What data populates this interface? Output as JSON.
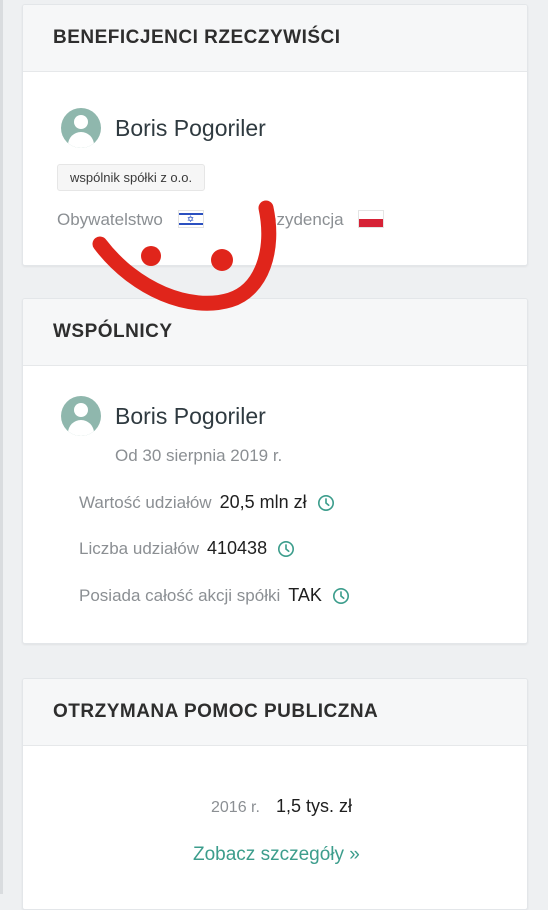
{
  "beneficiaries": {
    "title": "BENEFICJENCI RZECZYWIŚCI",
    "person_name": "Boris Pogoriler",
    "role": "wspólnik spółki z o.o.",
    "citizenship_label": "Obywatelstwo",
    "residence_label": "ezydencja",
    "citizenship_flag_icon": "israel-flag-icon",
    "residence_flag_icon": "poland-flag-icon"
  },
  "partners": {
    "title": "WSPÓLNICY",
    "person_name": "Boris Pogoriler",
    "since": "Od 30 sierpnia 2019 r.",
    "share_value_label": "Wartość udziałów",
    "share_value": "20,5 mln zł",
    "share_count_label": "Liczba udziałów",
    "share_count": "410438",
    "owns_all_label": "Posiada całość akcji spółki",
    "owns_all": "TAK"
  },
  "public_aid": {
    "title": "OTRZYMANA POMOC PUBLICZNA",
    "year": "2016 r.",
    "amount": "1,5 tys. zł",
    "details_link": "Zobacz szczegóły »"
  },
  "colors": {
    "accent": "#3c9d8c",
    "avatar": "#8fb7ad",
    "scribble": "#e0251b"
  }
}
